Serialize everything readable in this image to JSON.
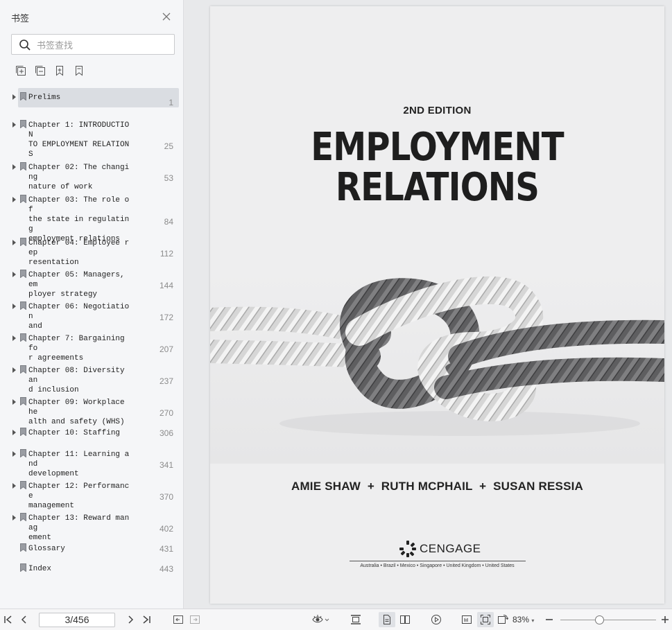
{
  "sidebar": {
    "title": "书签",
    "search_placeholder": "书签查找",
    "bookmarks": [
      {
        "title": "Prelims",
        "page": "1",
        "expandable": true,
        "selected": true
      },
      {
        "title": "Chapter 1: INTRODUCTION TO EMPLOYMENT RELATIONS",
        "page": "25",
        "expandable": true
      },
      {
        "title": "Chapter 02: The changing nature of work",
        "page": "53",
        "expandable": true
      },
      {
        "title": "Chapter 03: The role of the state in regulating employment relations",
        "page": "84",
        "expandable": true
      },
      {
        "title": "Chapter 04: Employee representation",
        "page": "112",
        "expandable": true
      },
      {
        "title": "Chapter 05: Managers, employer strategy",
        "page": "144",
        "expandable": true
      },
      {
        "title": "Chapter 06: Negotiation and",
        "page": "172",
        "expandable": true
      },
      {
        "title": "Chapter 7: Bargaining for agreements",
        "page": "207",
        "expandable": true
      },
      {
        "title": "Chapter 08: Diversity and inclusion",
        "page": "237",
        "expandable": true
      },
      {
        "title": "Chapter 09: Workplace health and safety (WHS)",
        "page": "270",
        "expandable": true
      },
      {
        "title": "Chapter 10: Staffing",
        "page": "306",
        "expandable": true
      },
      {
        "title": "Chapter 11: Learning and development",
        "page": "341",
        "expandable": true
      },
      {
        "title": "Chapter 12: Performance management",
        "page": "370",
        "expandable": true
      },
      {
        "title": "Chapter 13: Reward management",
        "page": "402",
        "expandable": true
      },
      {
        "title": "Glossary",
        "page": "431",
        "expandable": false
      },
      {
        "title": "Index",
        "page": "443",
        "expandable": false
      }
    ]
  },
  "cover": {
    "edition": "2ND EDITION",
    "title_line1": "EMPLOYMENT",
    "title_line2": "RELATIONS",
    "authors": "AMIE SHAW  +  RUTH MCPHAIL  +  SUSAN RESSIA",
    "publisher": "CENGAGE",
    "countries": "Australia • Brazil • Mexico • Singapore • United Kingdom • United States"
  },
  "toolbar": {
    "page_indicator": "3/456",
    "zoom": "83%"
  }
}
